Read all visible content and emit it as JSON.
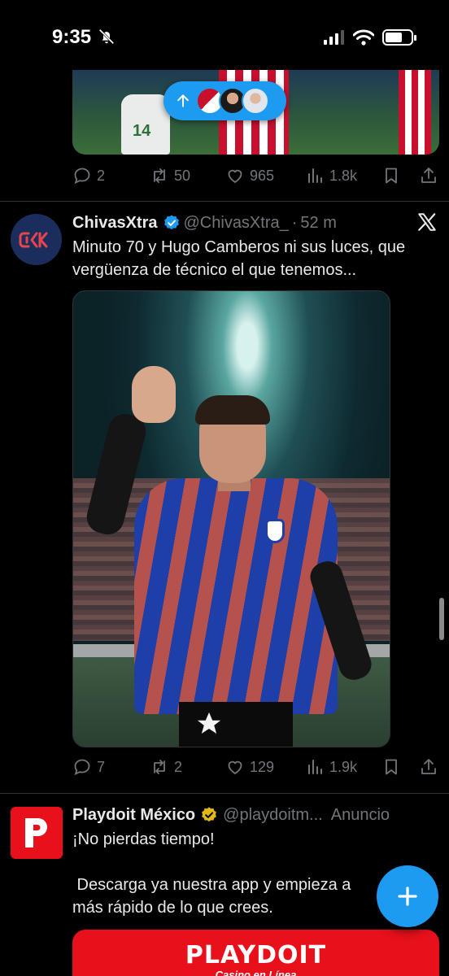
{
  "status_bar": {
    "time": "9:35"
  },
  "new_posts_pill": {
    "avatars": [
      "chivas-logo",
      "user-avatar-1",
      "user-avatar-2"
    ]
  },
  "previous_tweet": {
    "replies": "2",
    "reposts": "50",
    "likes": "965",
    "views": "1.8k"
  },
  "tweet": {
    "name": "ChivasXtra",
    "handle": "@ChivasXtra_",
    "separator": "·",
    "time": "52 m",
    "text_line1": "Minuto 70 y Hugo Camberos ni sus luces, que",
    "text_line2": "vergüenza de técnico el que tenemos...",
    "replies": "7",
    "reposts": "2",
    "likes": "129",
    "views": "1.9k"
  },
  "ad": {
    "name": "Playdoit México",
    "handle": "@playdoitm...",
    "label": "Anuncio",
    "text_line1": "¡No pierdas tiempo!",
    "text_line2": " Descarga ya nuestra app y empieza a",
    "text_line3": "más rápido de lo que crees.",
    "brand": "PLAYDOIT",
    "brand_sub": "Casino en Línea"
  },
  "colors": {
    "background": "#000000",
    "accent_blue": "#1d9bf0",
    "muted_text": "#71767b",
    "divider": "#2f3336",
    "playdoit_red": "#e8101a",
    "gold_badge": "#e2b719"
  },
  "icons": [
    "bell-slash-icon",
    "signal-icon",
    "wifi-icon",
    "battery-icon",
    "arrow-up-icon",
    "reply-icon",
    "repost-icon",
    "like-icon",
    "views-icon",
    "bookmark-icon",
    "share-icon",
    "verified-icon",
    "x-logo-icon",
    "plus-icon"
  ]
}
